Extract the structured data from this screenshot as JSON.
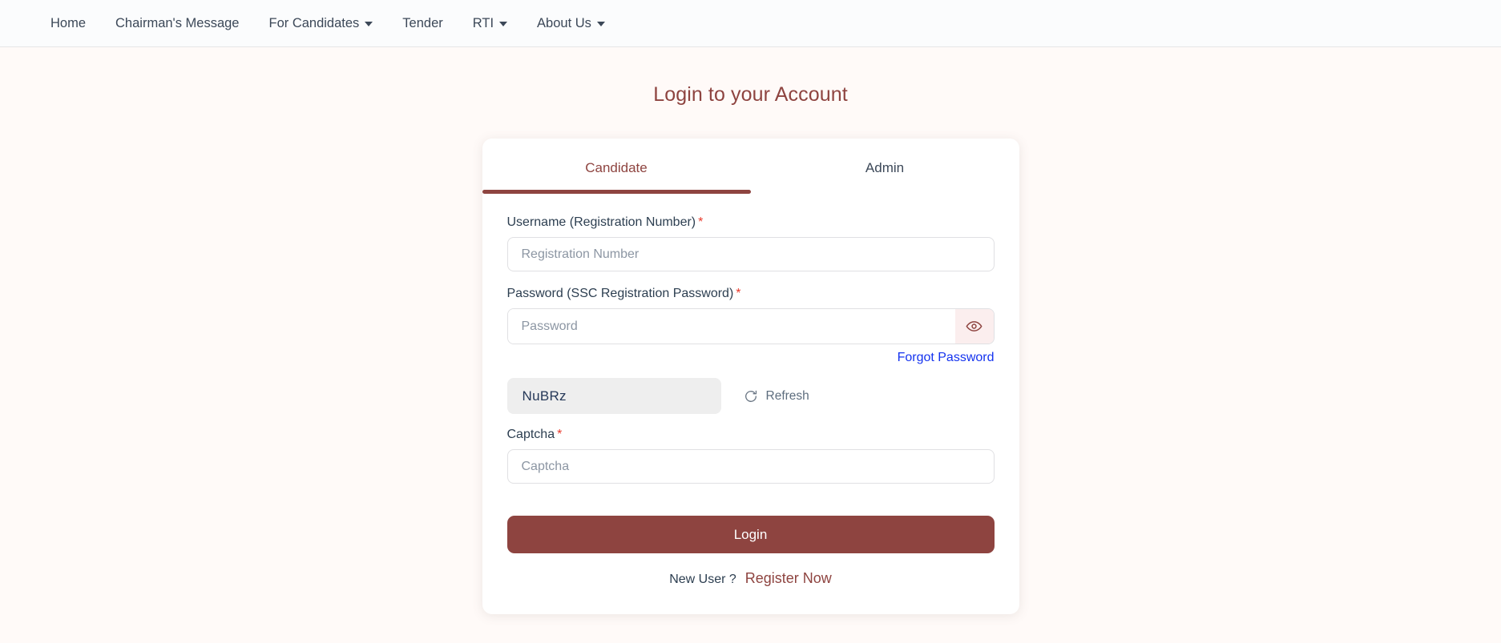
{
  "navbar": {
    "items": [
      {
        "label": "Home",
        "has_dropdown": false
      },
      {
        "label": "Chairman's Message",
        "has_dropdown": false
      },
      {
        "label": "For Candidates",
        "has_dropdown": true
      },
      {
        "label": "Tender",
        "has_dropdown": false
      },
      {
        "label": "RTI",
        "has_dropdown": true
      },
      {
        "label": "About Us",
        "has_dropdown": true
      }
    ]
  },
  "page": {
    "title": "Login to your Account"
  },
  "card": {
    "tabs": [
      {
        "label": "Candidate",
        "active": true
      },
      {
        "label": "Admin",
        "active": false
      }
    ],
    "username": {
      "label": "Username (Registration Number)",
      "required_mark": "*",
      "placeholder": "Registration Number",
      "value": ""
    },
    "password": {
      "label": "Password (SSC Registration Password)",
      "required_mark": "*",
      "placeholder": "Password",
      "value": "",
      "toggle_icon": "eye-icon"
    },
    "forgot_password": {
      "label": "Forgot Password"
    },
    "captcha_display": {
      "value": "NuBRz",
      "refresh_label": "Refresh",
      "refresh_icon": "refresh-icon"
    },
    "captcha_input": {
      "label": "Captcha",
      "required_mark": "*",
      "placeholder": "Captcha",
      "value": ""
    },
    "login_button": {
      "label": "Login"
    },
    "footer": {
      "new_user_text": "New User ?",
      "register_label": "Register Now"
    }
  },
  "colors": {
    "accent": "#8e4440",
    "page_background": "#fffaf8",
    "navbar_background": "#fbfcfd",
    "link_blue": "#1433ef",
    "required_red": "#e8392b",
    "captcha_background": "#eeeeee",
    "eye_button_background": "#fbeeee"
  }
}
